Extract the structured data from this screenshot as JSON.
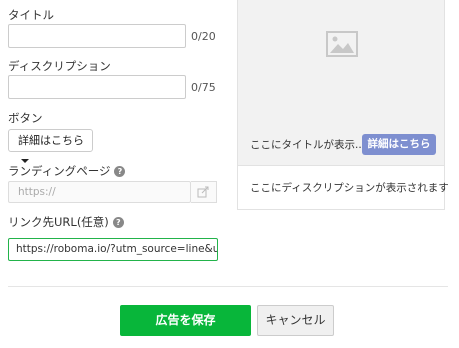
{
  "form": {
    "title_label": "タイトル",
    "title_value": "",
    "title_counter": "0/20",
    "description_label": "ディスクリプション",
    "description_value": "",
    "description_counter": "0/75",
    "button_label": "ボタン",
    "button_selected": "詳細はこちら",
    "landing_page_label": "ランディングページ",
    "landing_page_placeholder": "https://",
    "link_url_label": "リンク先URL(任意)",
    "link_url_value": "https://roboma.io/?utm_source=line&utm_me",
    "help_icon_glyph": "?"
  },
  "preview": {
    "image_placeholder_icon": "image-icon",
    "title": "ここにタイトルが表示...",
    "cta_label": "詳細はこちら",
    "description": "ここにディスクリプションが表示されます"
  },
  "actions": {
    "save_label": "広告を保存",
    "cancel_label": "キャンセル"
  },
  "colors": {
    "primary_green": "#08b63a",
    "cta_blue": "#7e8fd0",
    "focus_border": "#22b34a"
  }
}
